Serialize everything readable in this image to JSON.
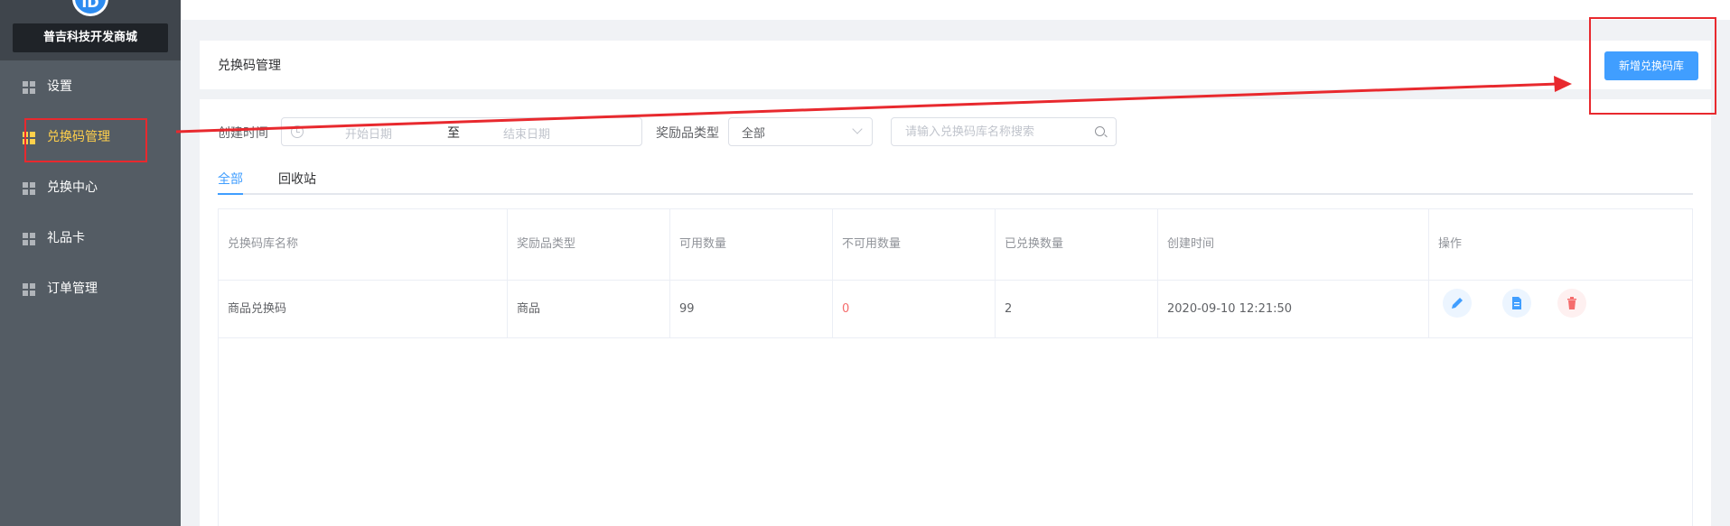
{
  "sidebar": {
    "logo_text": "ID",
    "store_name": "普吉科技开发商城",
    "items": [
      {
        "label": "设置",
        "active": false
      },
      {
        "label": "兑换码管理",
        "active": true
      },
      {
        "label": "兑换中心",
        "active": false
      },
      {
        "label": "礼品卡",
        "active": false
      },
      {
        "label": "订单管理",
        "active": false
      }
    ]
  },
  "header": {
    "title": "兑换码管理",
    "add_button": "新增兑换码库"
  },
  "filters": {
    "created_label": "创建时间",
    "start_placeholder": "开始日期",
    "range_sep": "至",
    "end_placeholder": "结束日期",
    "reward_type_label": "奖励品类型",
    "reward_type_value": "全部",
    "search_placeholder": "请输入兑换码库名称搜索"
  },
  "tabs": [
    {
      "label": "全部",
      "active": true
    },
    {
      "label": "回收站",
      "active": false
    }
  ],
  "table": {
    "columns": [
      "兑换码库名称",
      "奖励品类型",
      "可用数量",
      "不可用数量",
      "已兑换数量",
      "创建时间",
      "操作"
    ],
    "rows": [
      {
        "name": "商品兑换码",
        "type": "商品",
        "available": "99",
        "unavailable": "0",
        "redeemed": "2",
        "created": "2020-09-10 12:21:50"
      }
    ]
  },
  "colors": {
    "primary": "#409eff",
    "active_menu": "#ffd04b",
    "danger": "#f56c6c",
    "annotation": "#e8292e",
    "sidebar_bg": "#545c64"
  },
  "icons": [
    "grid-icon",
    "clock-icon",
    "chevron-down-icon",
    "search-icon",
    "edit-icon",
    "document-icon",
    "delete-icon"
  ]
}
